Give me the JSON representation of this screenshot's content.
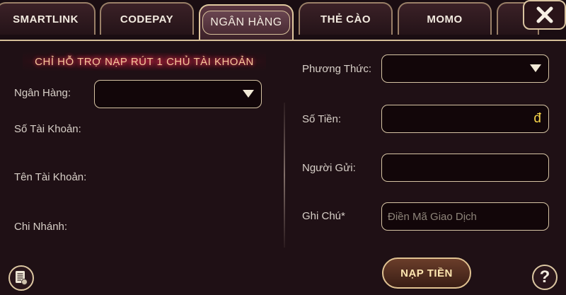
{
  "tabs": [
    {
      "label": "SMARTLINK"
    },
    {
      "label": "CODEPAY"
    },
    {
      "label": "NGÂN HÀNG"
    },
    {
      "label": "THẺ CÀO"
    },
    {
      "label": "MOMO"
    }
  ],
  "notice": "CHỈ HỖ TRỢ NẠP RÚT 1 CHỦ TÀI KHOẢN",
  "left": {
    "bank_label": "Ngân Hàng:",
    "account_number_label": "Số Tài Khoản:",
    "account_name_label": "Tên Tài Khoản:",
    "branch_label": "Chi Nhánh:"
  },
  "right": {
    "method_label": "Phương Thức:",
    "amount_label": "Số Tiền:",
    "currency_symbol": "đ",
    "sender_label": "Người Gửi:",
    "note_label": "Ghi Chú*",
    "note_placeholder": "Điền Mã Giao Dịch"
  },
  "submit_label": "NẠP TIỀN",
  "help_label": "?",
  "colors": {
    "accent": "#d6bf98",
    "currency": "#f3d24a",
    "notice_glow": "#ff3050"
  },
  "icons": [
    "close-icon",
    "dropdown-caret-icon",
    "history-icon",
    "help-icon"
  ]
}
